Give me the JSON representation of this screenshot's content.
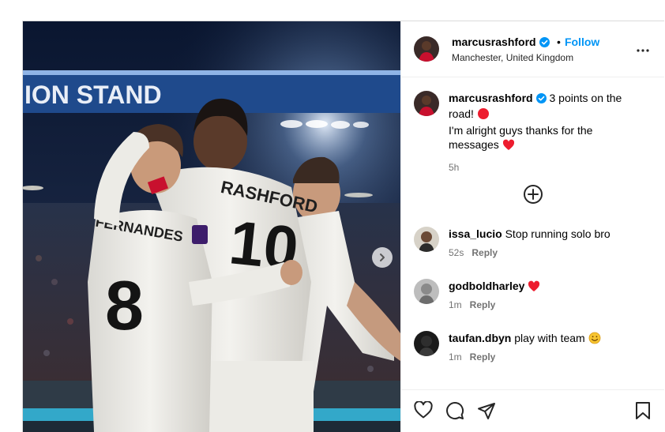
{
  "photo": {
    "stand_text": "ION STAND",
    "player_left_name": "FERNANDES",
    "player_left_number": "8",
    "player_center_name": "RASHFORD",
    "player_center_number": "10"
  },
  "header": {
    "username": "marcusrashford",
    "separator": "•",
    "follow_label": "Follow",
    "location": "Manchester, United Kingdom"
  },
  "caption": {
    "username": "marcusrashford",
    "line1": "3 points on the road!",
    "line2": "I'm alright guys thanks for the messages",
    "time": "5h"
  },
  "comments": [
    {
      "username": "issa_lucio",
      "text": "Stop running solo bro",
      "time": "52s",
      "reply": "Reply"
    },
    {
      "username": "godboldharley",
      "text": "",
      "time": "1m",
      "reply": "Reply"
    },
    {
      "username": "taufan.dbyn",
      "text": "play with team",
      "time": "1m",
      "reply": "Reply"
    }
  ],
  "icons": {
    "verified": "verified-badge-icon",
    "more": "more-options-icon",
    "add": "add-circle-icon",
    "like": "heart-outline-icon",
    "comment": "comment-bubble-icon",
    "share": "paper-plane-icon",
    "save": "bookmark-icon",
    "next": "chevron-right-icon"
  },
  "colors": {
    "link_blue": "#0095f6",
    "verified_blue": "#0095f6",
    "heart_red": "#ed1c2e",
    "muted": "#737373"
  }
}
